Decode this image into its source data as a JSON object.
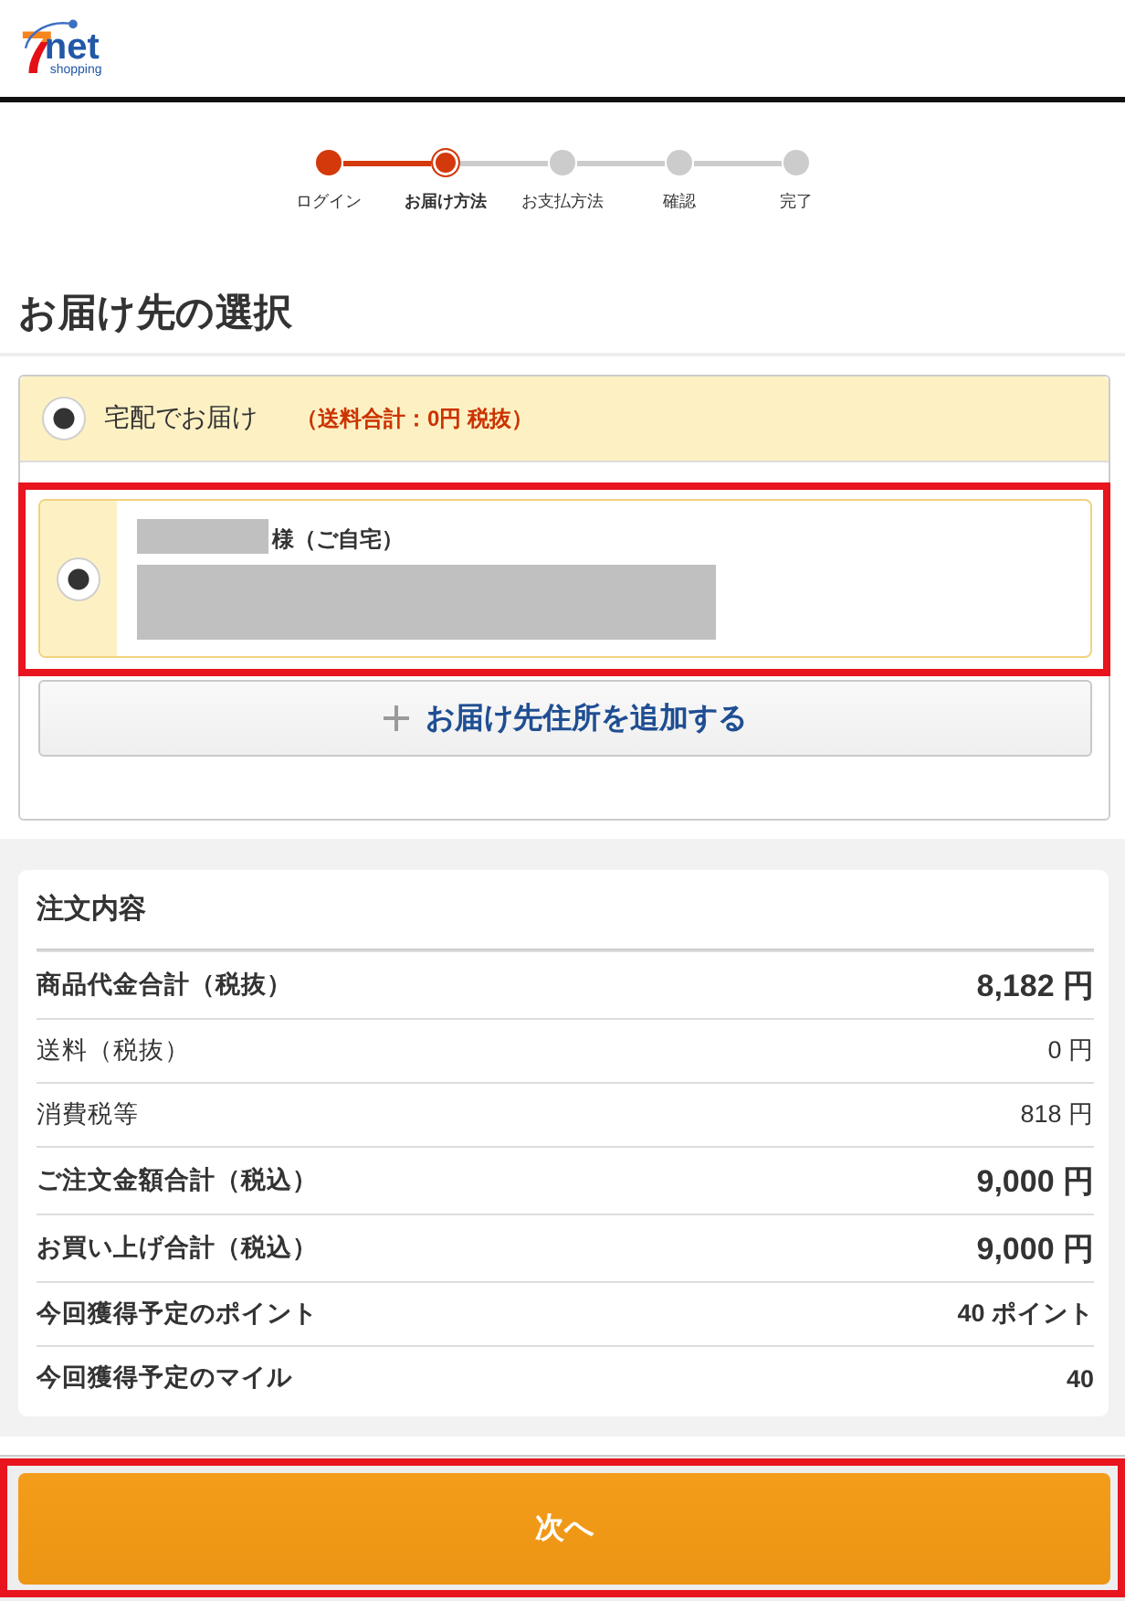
{
  "header": {
    "logo": {
      "numeral": "7",
      "word": "net",
      "tagline": "shopping"
    }
  },
  "steps": [
    {
      "label": "ログイン",
      "completed": true,
      "selected": false
    },
    {
      "label": "お届け方法",
      "completed": false,
      "selected": true
    },
    {
      "label": "お支払方法",
      "completed": false,
      "selected": false
    },
    {
      "label": "確認",
      "completed": false,
      "selected": false
    },
    {
      "label": "完了",
      "completed": false,
      "selected": false
    }
  ],
  "page_title": "お届け先の選択",
  "delivery": {
    "method": {
      "label": "宅配でお届け",
      "note": "（送料合計：0円 税抜）",
      "selected": true
    },
    "addresses": [
      {
        "name_suffix": "様（ご自宅）",
        "selected": true,
        "highlighted": true
      }
    ],
    "add_address_button": {
      "label": "お届け先住所を追加する"
    }
  },
  "order_summary": {
    "title": "注文内容",
    "rows": [
      {
        "label": "商品代金合計（税抜）",
        "value": "8,182 円",
        "kind": "total"
      },
      {
        "label": "送料（税抜）",
        "value": "0 円",
        "kind": "plain"
      },
      {
        "label": "消費税等",
        "value": "818 円",
        "kind": "plain"
      },
      {
        "label": "ご注文金額合計（税込）",
        "value": "9,000 円",
        "kind": "total"
      },
      {
        "label": "お買い上げ合計（税込）",
        "value": "9,000 円",
        "kind": "total"
      },
      {
        "label": "今回獲得予定のポイント",
        "value": "40 ポイント",
        "kind": "strong"
      },
      {
        "label": "今回獲得予定のマイル",
        "value": "40",
        "kind": "strong"
      }
    ]
  },
  "next_button": {
    "label": "次へ",
    "highlighted": true
  }
}
